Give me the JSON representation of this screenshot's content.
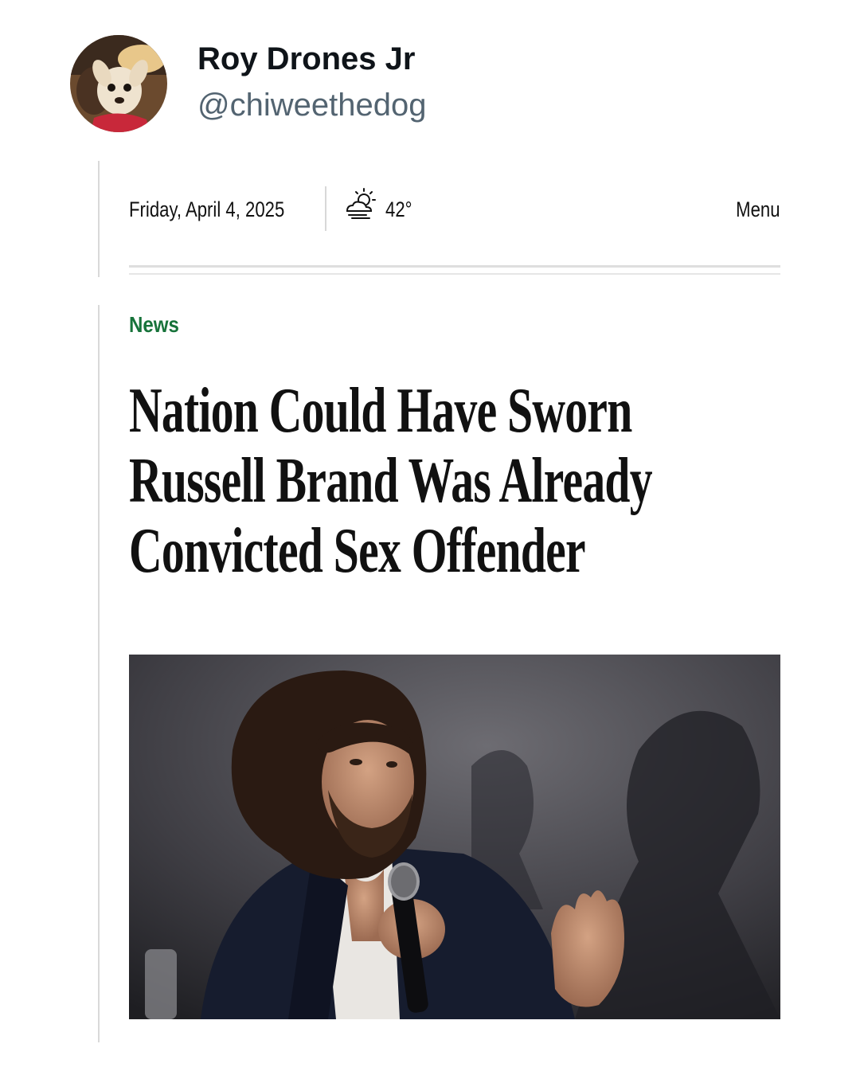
{
  "tweet": {
    "author_name": "Roy Drones Jr",
    "author_handle": "@chiweethedog",
    "avatar_icon": "chihuahua-avatar"
  },
  "article": {
    "date": "Friday, April 4, 2025",
    "weather": {
      "icon": "partly-cloudy-icon",
      "temperature": "42°"
    },
    "menu_label": "Menu",
    "section": "News",
    "headline_lines": [
      "Nation Could Have Sworn",
      "Russell Brand Was Already",
      "Convicted Sex Offender"
    ],
    "image_icon": "man-speaking-into-microphone-photo",
    "colors": {
      "section_green": "#17733a",
      "headline": "#111111",
      "handle_gray": "#536471"
    }
  }
}
